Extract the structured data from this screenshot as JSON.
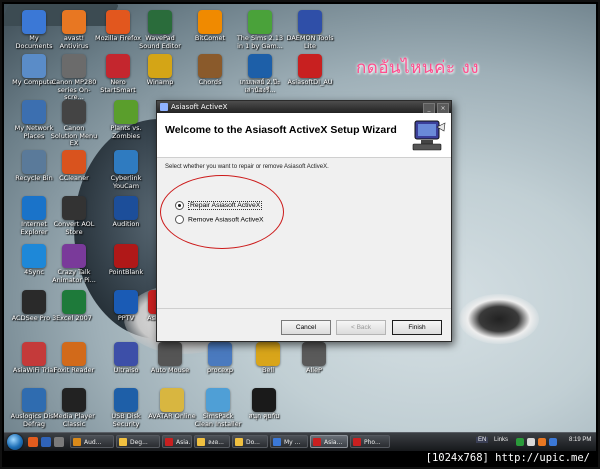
{
  "desktop": {
    "overlay_text": "กดอันไหนค่ะ งง",
    "overlay_color": "#ff4d8d",
    "icons": [
      {
        "label": "My Documents",
        "icon": "folder-docs-icon",
        "color": "#3b78d6"
      },
      {
        "label": "avast! Antivirus",
        "icon": "avast-icon",
        "color": "#e87722"
      },
      {
        "label": "Mozilla Firefox",
        "icon": "firefox-icon",
        "color": "#e2571e"
      },
      {
        "label": "WavePad Sound Editor",
        "icon": "wavepad-icon",
        "color": "#2a6c3b"
      },
      {
        "label": "BitComet",
        "icon": "bitcomet-icon",
        "color": "#f08a00"
      },
      {
        "label": "The Sims 2.13 in 1 by Gam...",
        "icon": "sims-icon",
        "color": "#4aa23a"
      },
      {
        "label": "DAEMON Tools Lite",
        "icon": "daemon-tools-icon",
        "color": "#2f4fa8"
      },
      {
        "label": "My Computer",
        "icon": "computer-icon",
        "color": "#5a8cc8"
      },
      {
        "label": "Canon MP280 series On-scre...",
        "icon": "canon-icon",
        "color": "#6b6b6b"
      },
      {
        "label": "Nero StartSmart",
        "icon": "nero-icon",
        "color": "#c4262e"
      },
      {
        "label": "Winamp",
        "icon": "winamp-icon",
        "color": "#d4a516"
      },
      {
        "label": "Chords",
        "icon": "chords-icon",
        "color": "#8a5a2b"
      },
      {
        "label": "เกมเพลย์ 2.ป๊ะ เล่าน้องรี...",
        "icon": "game-icon",
        "color": "#1d5fa8"
      },
      {
        "label": "AsiasoftDI_AU",
        "icon": "asiasoft-icon",
        "color": "#c82020"
      },
      {
        "label": "My Network Places",
        "icon": "network-icon",
        "color": "#3c6fb0"
      },
      {
        "label": "Canon Solution Menu EX",
        "icon": "canon-menu-icon",
        "color": "#444"
      },
      {
        "label": "Plants vs. Zombies",
        "icon": "pvz-icon",
        "color": "#5a9e2c"
      },
      {
        "label": "Recycle Bin",
        "icon": "recycle-bin-icon",
        "color": "#5a7a9a"
      },
      {
        "label": "CCleaner",
        "icon": "ccleaner-icon",
        "color": "#d9531e"
      },
      {
        "label": "Cyberlink YouCam",
        "icon": "youcam-icon",
        "color": "#2f7bc0"
      },
      {
        "label": "Internet Explorer",
        "icon": "ie-icon",
        "color": "#1a73c9"
      },
      {
        "label": "Convert AOL Store",
        "icon": "aol-icon",
        "color": "#333"
      },
      {
        "label": "Audition",
        "icon": "audition-icon",
        "color": "#1c4e9a"
      },
      {
        "label": "4Sync",
        "icon": "4sync-icon",
        "color": "#1e88d8"
      },
      {
        "label": "Crazy Talk Animator Pi...",
        "icon": "crazytalk-icon",
        "color": "#7a3a9a"
      },
      {
        "label": "PointBlank",
        "icon": "pointblank-icon",
        "color": "#b01818"
      },
      {
        "label": "ACDSee Pro 3",
        "icon": "acdsee-icon",
        "color": "#2a2a2a"
      },
      {
        "label": "Excel 2007",
        "icon": "excel-icon",
        "color": "#1e7a3a"
      },
      {
        "label": "PPTV",
        "icon": "pptv-icon",
        "color": "#1a5bb5"
      },
      {
        "label": "Asiasoft",
        "icon": "asiasoft-shortcut-icon",
        "color": "#c82020"
      },
      {
        "label": "AsiaWiFi Trial",
        "icon": "asiawifi-icon",
        "color": "#c43a3a"
      },
      {
        "label": "Foxit Reader",
        "icon": "foxit-icon",
        "color": "#d26a1a"
      },
      {
        "label": "Ultraiso",
        "icon": "ultraiso-icon",
        "color": "#3d4fa8"
      },
      {
        "label": "Auto Mouse",
        "icon": "automouse-icon",
        "color": "#555"
      },
      {
        "label": "procexp",
        "icon": "procexp-icon",
        "color": "#4a7abf"
      },
      {
        "label": "Bell",
        "icon": "bell-icon",
        "color": "#d9a51a"
      },
      {
        "label": "AlleP",
        "icon": "allep-icon",
        "color": "#5a5a5a"
      },
      {
        "label": "Auslogics Disk Defrag",
        "icon": "defrag-icon",
        "color": "#2f6cb0"
      },
      {
        "label": "Media Player Classic",
        "icon": "mpc-icon",
        "color": "#222"
      },
      {
        "label": "USB Disk Security",
        "icon": "usb-security-icon",
        "color": "#1e5fa8"
      },
      {
        "label": "AVATAR Online",
        "icon": "avatar-online-icon",
        "color": "#d8b640"
      },
      {
        "label": "SimsPack Clean Installer",
        "icon": "simspack-icon",
        "color": "#4f9fd6"
      },
      {
        "label": "สนุก คุยกับ",
        "icon": "qq-icon",
        "color": "#1a1a1a"
      }
    ]
  },
  "dialog": {
    "title": "Asiasoft ActiveX",
    "heading": "Welcome to the Asiasoft ActiveX Setup Wizard",
    "instruction": "Select whether you want to repair or remove Asiasoft ActiveX.",
    "options": [
      {
        "label": "Repair Asiasoft ActiveX",
        "selected": true
      },
      {
        "label": "Remove Asiasoft ActiveX",
        "selected": false
      }
    ],
    "buttons": {
      "cancel": "Cancel",
      "back": "< Back",
      "finish": "Finish"
    },
    "annotation_color": "#cc1a1a"
  },
  "taskbar": {
    "items": [
      {
        "label": "Aud...",
        "color": "#d98a1a",
        "active": false
      },
      {
        "label": "Deg...",
        "color": "#f0c040",
        "active": false
      },
      {
        "label": "Asia...",
        "color": "#c82020",
        "active": false
      },
      {
        "label": "ลงอ...",
        "color": "#f0c040",
        "active": false
      },
      {
        "label": "Do...",
        "color": "#f0c040",
        "active": false
      },
      {
        "label": "My ...",
        "color": "#3b78d6",
        "active": false
      },
      {
        "label": "Asia...",
        "color": "#c82020",
        "active": true
      },
      {
        "label": "Pho...",
        "color": "#c82020",
        "active": false
      }
    ],
    "lang": "EN",
    "links": "Links",
    "clock": "8:19 PM"
  },
  "watermark": "[1024x768] http://upic.me/"
}
